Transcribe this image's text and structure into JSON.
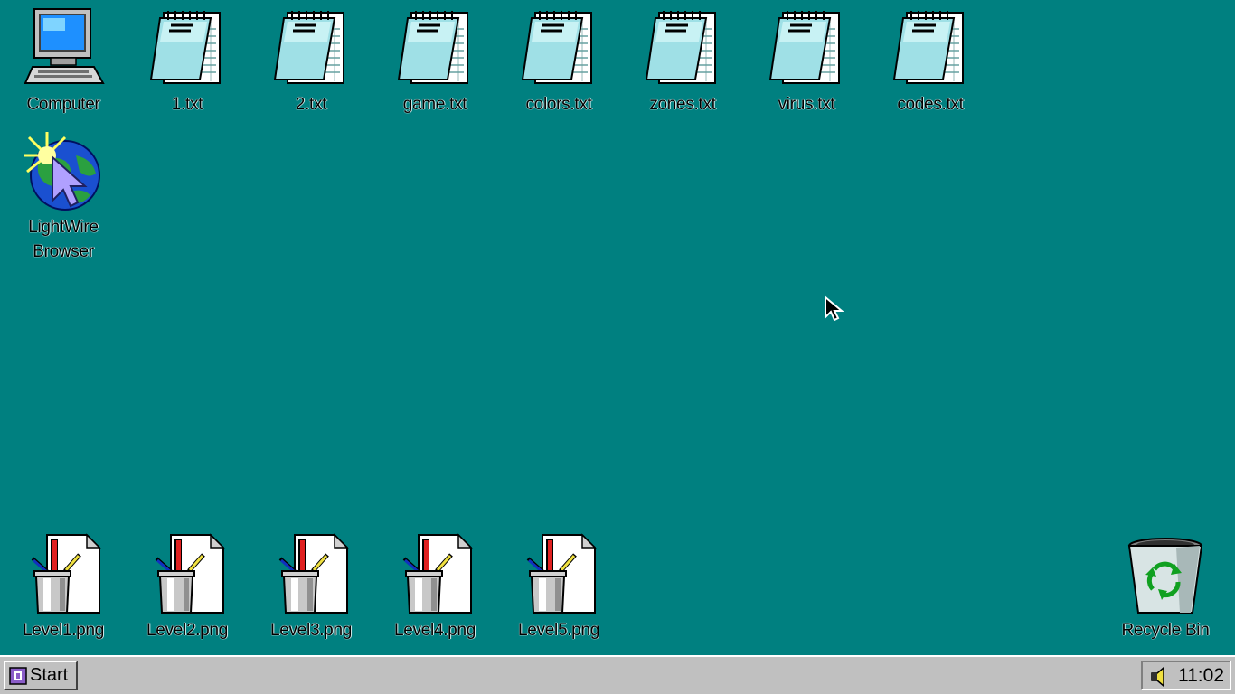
{
  "desktop": {
    "icons": {
      "computer": "Computer",
      "txt1": "1.txt",
      "txt2": "2.txt",
      "game": "game.txt",
      "colors": "colors.txt",
      "zones": "zones.txt",
      "virus": "virus.txt",
      "codes": "codes.txt",
      "browser": "LightWire\nBrowser",
      "level1": "Level1.png",
      "level2": "Level2.png",
      "level3": "Level3.png",
      "level4": "Level4.png",
      "level5": "Level5.png",
      "recycle": "Recycle Bin"
    },
    "background_color": "#008080"
  },
  "taskbar": {
    "start_label": "Start",
    "clock": "11:02"
  },
  "icon_names": {
    "notepad": "notepad-file-icon",
    "computer": "computer-icon",
    "browser": "browser-globe-icon",
    "paint": "paint-image-file-icon",
    "recycle": "recycle-bin-icon",
    "speaker": "speaker-icon"
  }
}
